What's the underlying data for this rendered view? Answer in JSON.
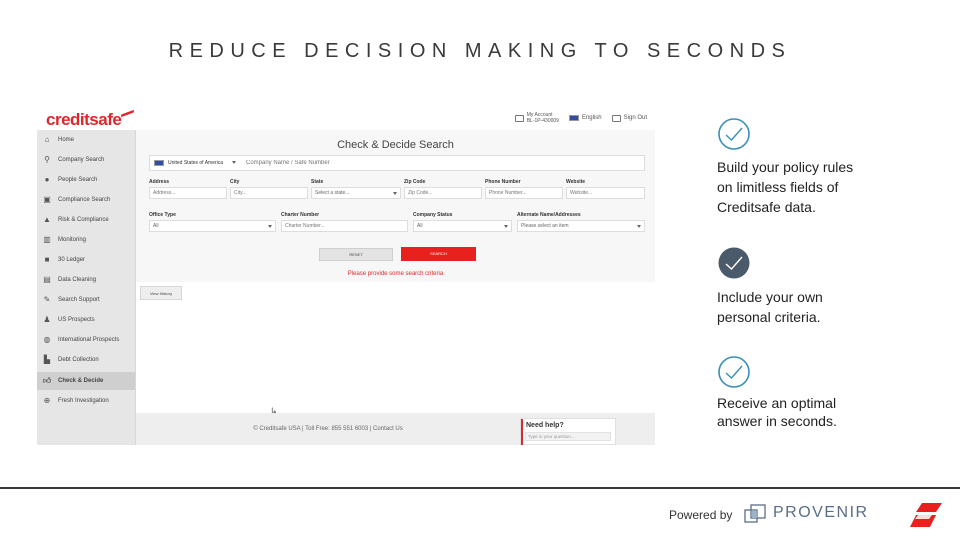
{
  "slide": {
    "title": "REDUCE DECISION MAKING TO SECONDS",
    "features": [
      {
        "text_lines": [
          "Build your policy rules",
          "on limitless fields of",
          "Creditsafe data."
        ],
        "icon": "check-outline-icon"
      },
      {
        "text_lines": [
          "Include your own",
          "personal criteria."
        ],
        "icon": "check-filled-icon"
      },
      {
        "text_lines": [
          "Receive an optimal",
          "answer in seconds."
        ],
        "icon": "check-outline-icon"
      }
    ],
    "powered_by": "Powered by",
    "partner_name": "PROVENIR"
  },
  "app": {
    "logo": "creditsafe",
    "top_right": {
      "account_label": "My Account",
      "account_id": "BL-1P-430009",
      "language": "English",
      "sign_out": "Sign Out"
    },
    "sidebar": {
      "items": [
        {
          "label": "Home",
          "icon": "home-icon"
        },
        {
          "label": "Company Search",
          "icon": "search-icon"
        },
        {
          "label": "People Search",
          "icon": "person-icon"
        },
        {
          "label": "Compliance Search",
          "icon": "folder-icon"
        },
        {
          "label": "Risk & Compliance",
          "icon": "warning-icon"
        },
        {
          "label": "Monitoring",
          "icon": "chart-icon"
        },
        {
          "label": "30 Ledger",
          "icon": "box-icon"
        },
        {
          "label": "Data Cleaning",
          "icon": "database-icon"
        },
        {
          "label": "Search Support",
          "icon": "leaf-icon"
        },
        {
          "label": "US Prospects",
          "icon": "people-icon"
        },
        {
          "label": "International Prospects",
          "icon": "globe-icon"
        },
        {
          "label": "Debt Collection",
          "icon": "factory-icon"
        },
        {
          "label": "Check & Decide",
          "icon": "thumbs-up-icon",
          "active": true
        },
        {
          "label": "Fresh Investigation",
          "icon": "magnifier-plus-icon"
        }
      ]
    },
    "form": {
      "title": "Check & Decide Search",
      "country": "United States of America",
      "company_placeholder": "Company Name / Safe Number",
      "fields_row1": [
        {
          "label": "Address",
          "placeholder": "Address..."
        },
        {
          "label": "City",
          "placeholder": "City..."
        },
        {
          "label": "State",
          "placeholder": "Select a state..."
        },
        {
          "label": "Zip Code",
          "placeholder": "Zip Code..."
        },
        {
          "label": "Phone Number",
          "placeholder": "Phone Number..."
        },
        {
          "label": "Website",
          "placeholder": "Website..."
        }
      ],
      "fields_row2": [
        {
          "label": "Office Type",
          "value": "All"
        },
        {
          "label": "Charter Number",
          "placeholder": "Charter Number..."
        },
        {
          "label": "Company Status",
          "value": "All"
        },
        {
          "label": "Alternate Name/Addresses",
          "value": "Please select an item"
        }
      ],
      "reset_label": "RESET",
      "search_label": "SEARCH",
      "error_message": "Please provide some search criteria",
      "view_history_label": "View History"
    },
    "footer": {
      "text": "© Creditsafe USA | Toll Free: 855 551 6003 | Contact Us"
    },
    "help": {
      "title": "Need help?",
      "placeholder": "Type in your question..."
    }
  },
  "colors": {
    "creditsafe_red": "#e0262d",
    "check_teal": "#3a8fb7",
    "check_dark": "#4a5a6a",
    "provenir_blue": "#5a6e88"
  }
}
